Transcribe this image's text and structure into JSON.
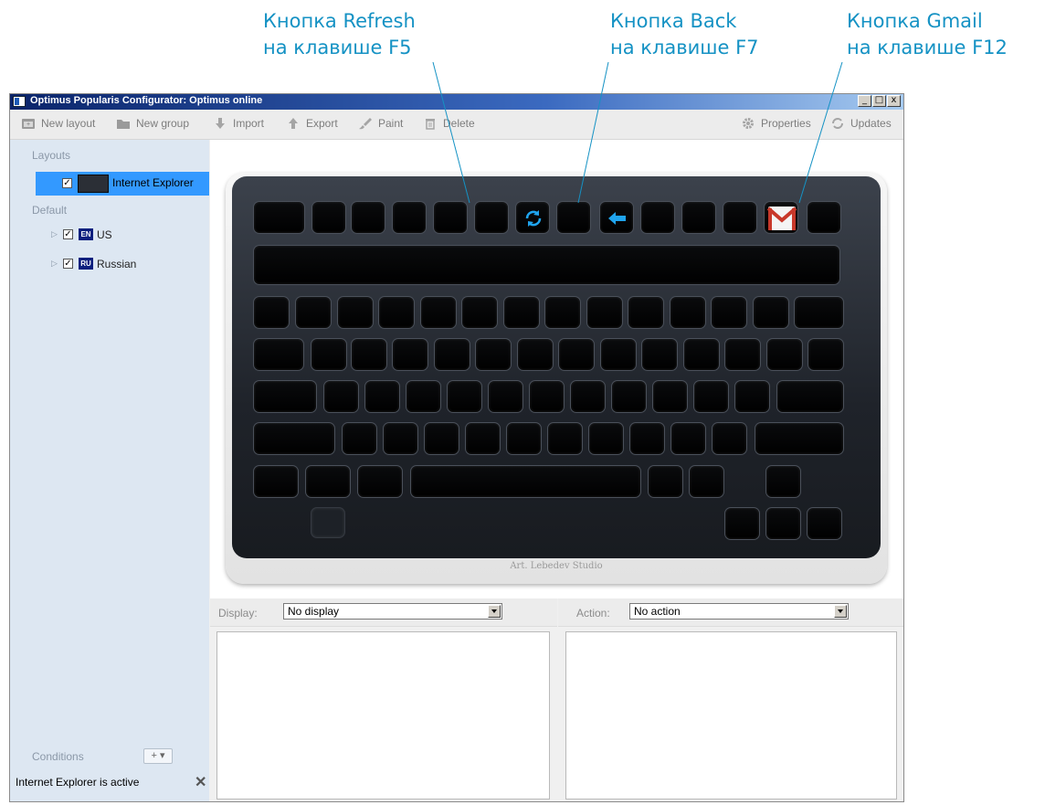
{
  "callouts": {
    "refresh": {
      "line1": "Кнопка Refresh",
      "line2": "на клавише F5"
    },
    "back": {
      "line1": "Кнопка Back",
      "line2": "на клавише F7"
    },
    "gmail": {
      "line1": "Кнопка Gmail",
      "line2": "на клавише F12"
    }
  },
  "window": {
    "title": "Optimus Popularis Configurator: Optimus online",
    "buttons": [
      "_",
      "□",
      "x"
    ]
  },
  "toolbar": {
    "new_layout": "New layout",
    "new_group": "New group",
    "import": "Import",
    "export": "Export",
    "paint": "Paint",
    "delete": "Delete",
    "properties": "Properties",
    "updates": "Updates"
  },
  "sidebar": {
    "layouts_label": "Layouts",
    "selected_layout": "Internet Explorer",
    "default_label": "Default",
    "items": [
      {
        "flag": "EN",
        "label": "US"
      },
      {
        "flag": "RU",
        "label": "Russian"
      }
    ],
    "conditions_label": "Conditions",
    "conditions_add": "+ ▾",
    "condition": "Internet Explorer is active"
  },
  "keyboard": {
    "brand": "Art. Lebedev Studio"
  },
  "bottom": {
    "display_label": "Display:",
    "display_value": "No display",
    "action_label": "Action:",
    "action_value": "No action"
  },
  "colors": {
    "callout": "#1592c4",
    "selection": "#3399ff",
    "sidebar": "#dde7f2",
    "key_icon_blue": "#1fa4ee",
    "gmail_red": "#c8382a"
  }
}
